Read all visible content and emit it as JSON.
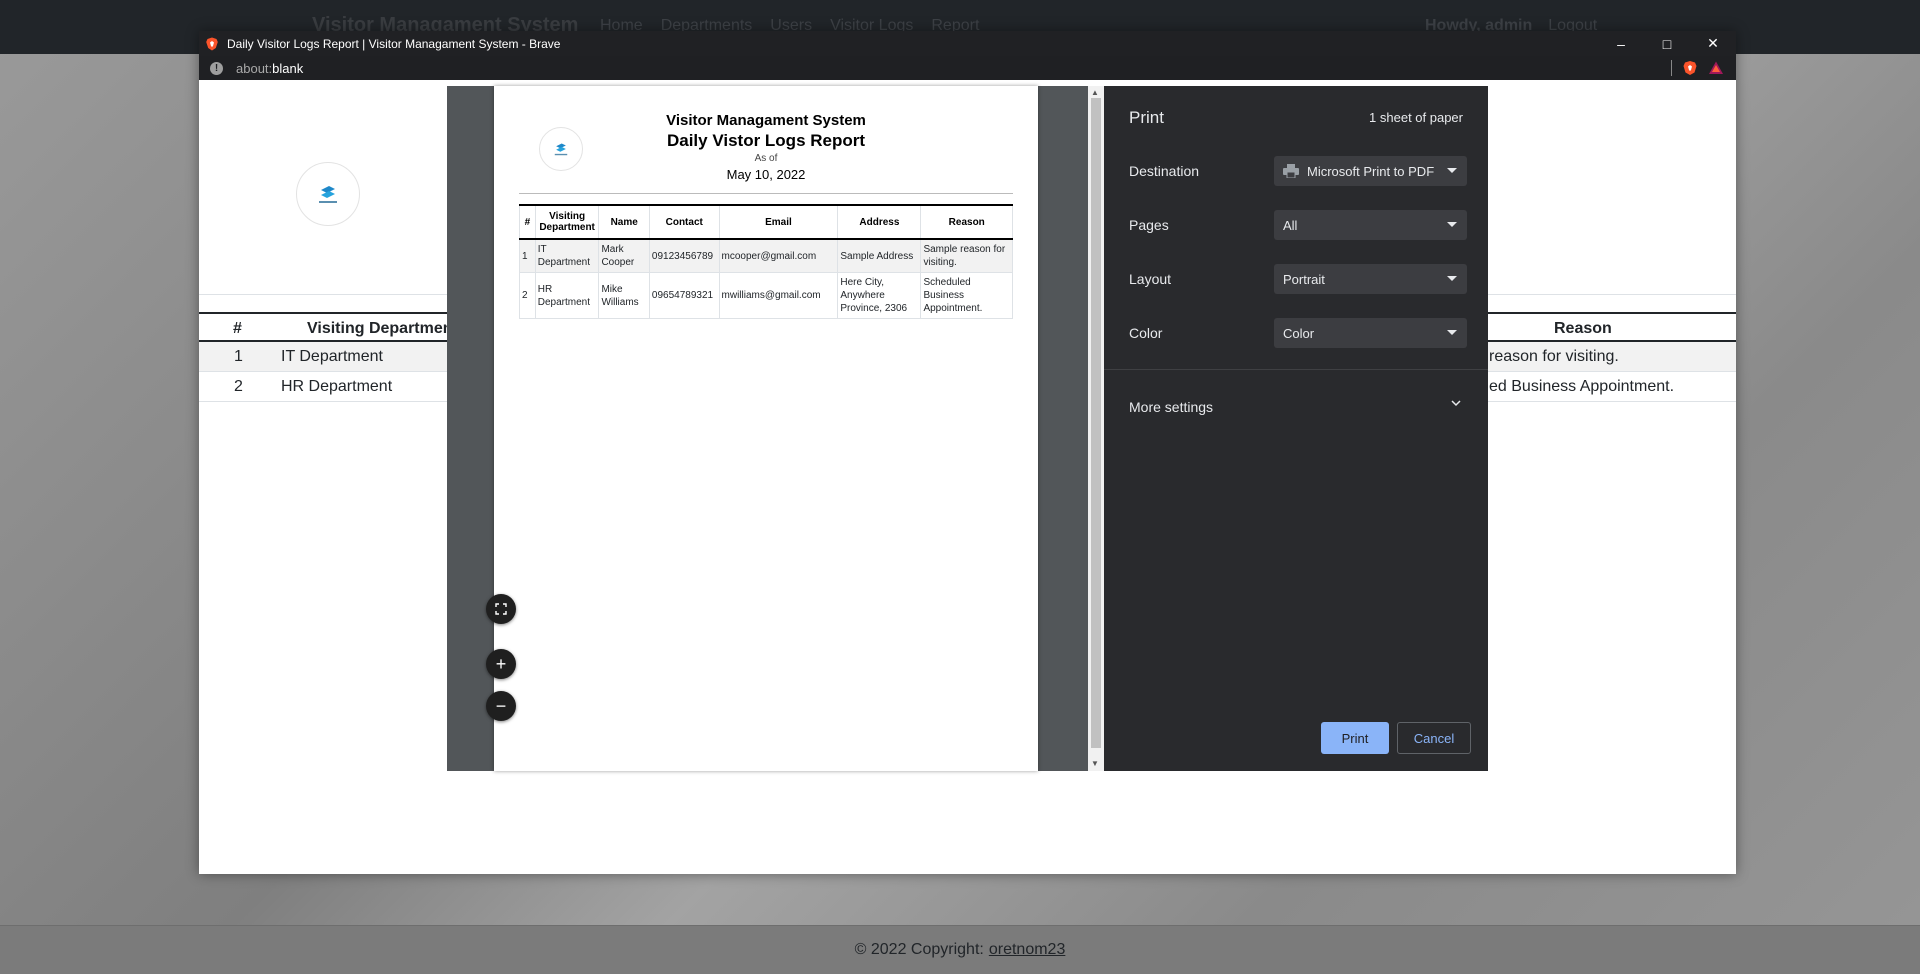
{
  "background": {
    "brand": "Visitor Managament System",
    "nav": [
      "Home",
      "Departments",
      "Users",
      "Visitor Logs",
      "Report"
    ],
    "user_greeting": "Howdy, admin",
    "logout": "Logout",
    "footer_text": "© 2022 Copyright:",
    "footer_link": "oretnom23"
  },
  "window": {
    "title": "Daily Visitor Logs Report | Visitor Managament System - Brave",
    "address_scheme": "about:",
    "address_host": "blank",
    "controls": [
      "minimize-icon",
      "maximize-icon",
      "close-icon"
    ]
  },
  "underlay": {
    "header_num": "#",
    "header_dept": "Visiting Departmen",
    "header_reason": "Reason",
    "rows": [
      {
        "num": "1",
        "dept": "IT Department",
        "reason": "reason for visiting."
      },
      {
        "num": "2",
        "dept": "HR Department",
        "reason": "ed Business Appointment."
      }
    ]
  },
  "report": {
    "system_title": "Visitor Managament System",
    "report_title": "Daily Vistor Logs Report",
    "as_of": "As of",
    "date": "May 10, 2022",
    "columns": [
      "#",
      "Visiting Department",
      "Name",
      "Contact",
      "Email",
      "Address",
      "Reason"
    ],
    "rows": [
      {
        "num": "1",
        "dept": "IT Department",
        "name": "Mark Cooper",
        "contact": "09123456789",
        "email": "mcooper@gmail.com",
        "address": "Sample Address",
        "reason": "Sample reason for visiting."
      },
      {
        "num": "2",
        "dept": "HR Department",
        "name": "Mike Williams",
        "contact": "09654789321",
        "email": "mwilliams@gmail.com",
        "address": "Here City, Anywhere Province, 2306",
        "reason": "Scheduled Business Appointment."
      }
    ]
  },
  "print": {
    "title": "Print",
    "sheets": "1 sheet of paper",
    "destination_label": "Destination",
    "destination_value": "Microsoft Print to PDF",
    "pages_label": "Pages",
    "pages_value": "All",
    "layout_label": "Layout",
    "layout_value": "Portrait",
    "color_label": "Color",
    "color_value": "Color",
    "more_settings": "More settings",
    "print_button": "Print",
    "cancel_button": "Cancel"
  },
  "colors": {
    "accent": "#8ab4f8",
    "dialog_bg": "#292a2d",
    "preview_bg": "#525659"
  }
}
